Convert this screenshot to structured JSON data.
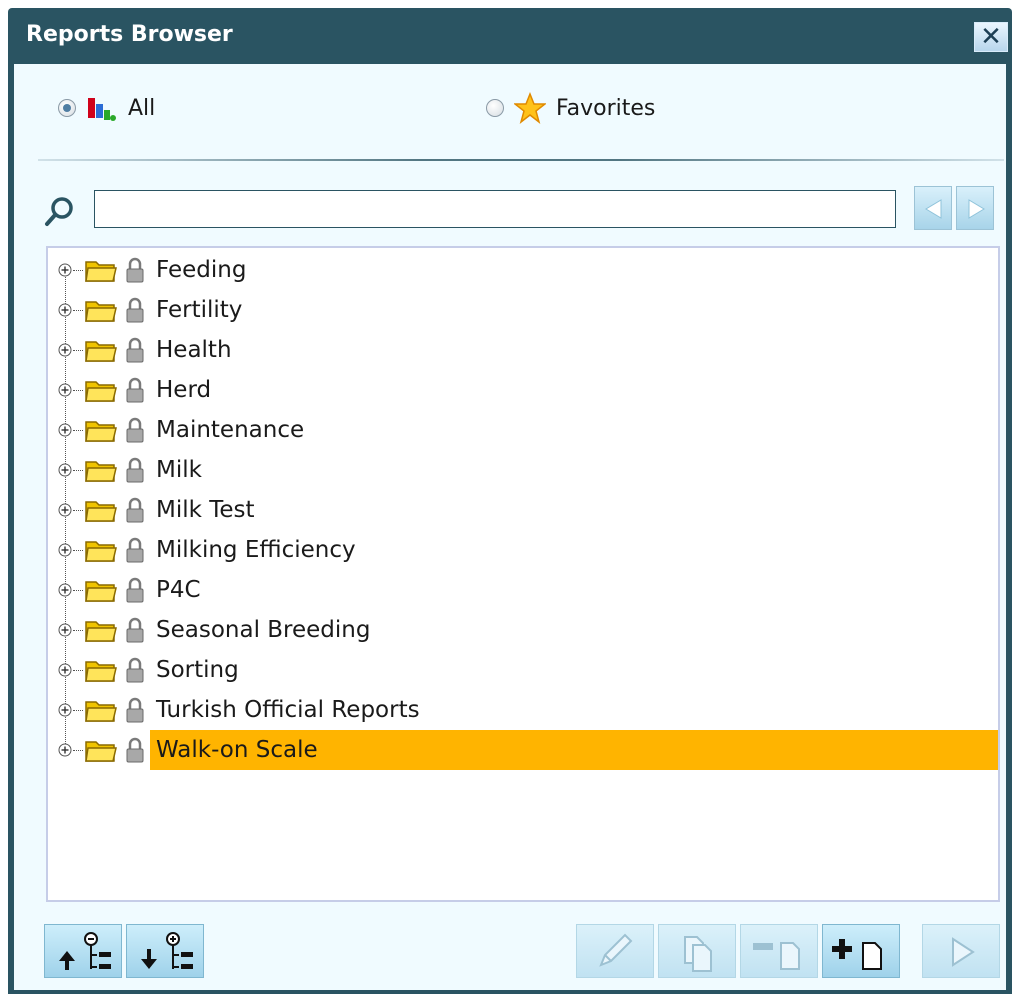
{
  "window": {
    "title": "Reports Browser"
  },
  "filter": {
    "options": [
      {
        "label": "All",
        "checked": true,
        "icon": "bar-chart-icon"
      },
      {
        "label": "Favorites",
        "checked": false,
        "icon": "star-icon"
      }
    ]
  },
  "search": {
    "value": "",
    "placeholder": ""
  },
  "tree": {
    "items": [
      {
        "label": "Feeding"
      },
      {
        "label": "Fertility"
      },
      {
        "label": "Health"
      },
      {
        "label": "Herd"
      },
      {
        "label": "Maintenance"
      },
      {
        "label": "Milk"
      },
      {
        "label": "Milk Test"
      },
      {
        "label": "Milking Efficiency"
      },
      {
        "label": "P4C"
      },
      {
        "label": "Seasonal Breeding"
      },
      {
        "label": "Sorting"
      },
      {
        "label": "Turkish Official Reports"
      },
      {
        "label": "Walk-on Scale",
        "selected": true
      }
    ]
  },
  "colors": {
    "title_bar": "#2a5462",
    "selection": "#ffb400",
    "background": "#f0fbff"
  }
}
